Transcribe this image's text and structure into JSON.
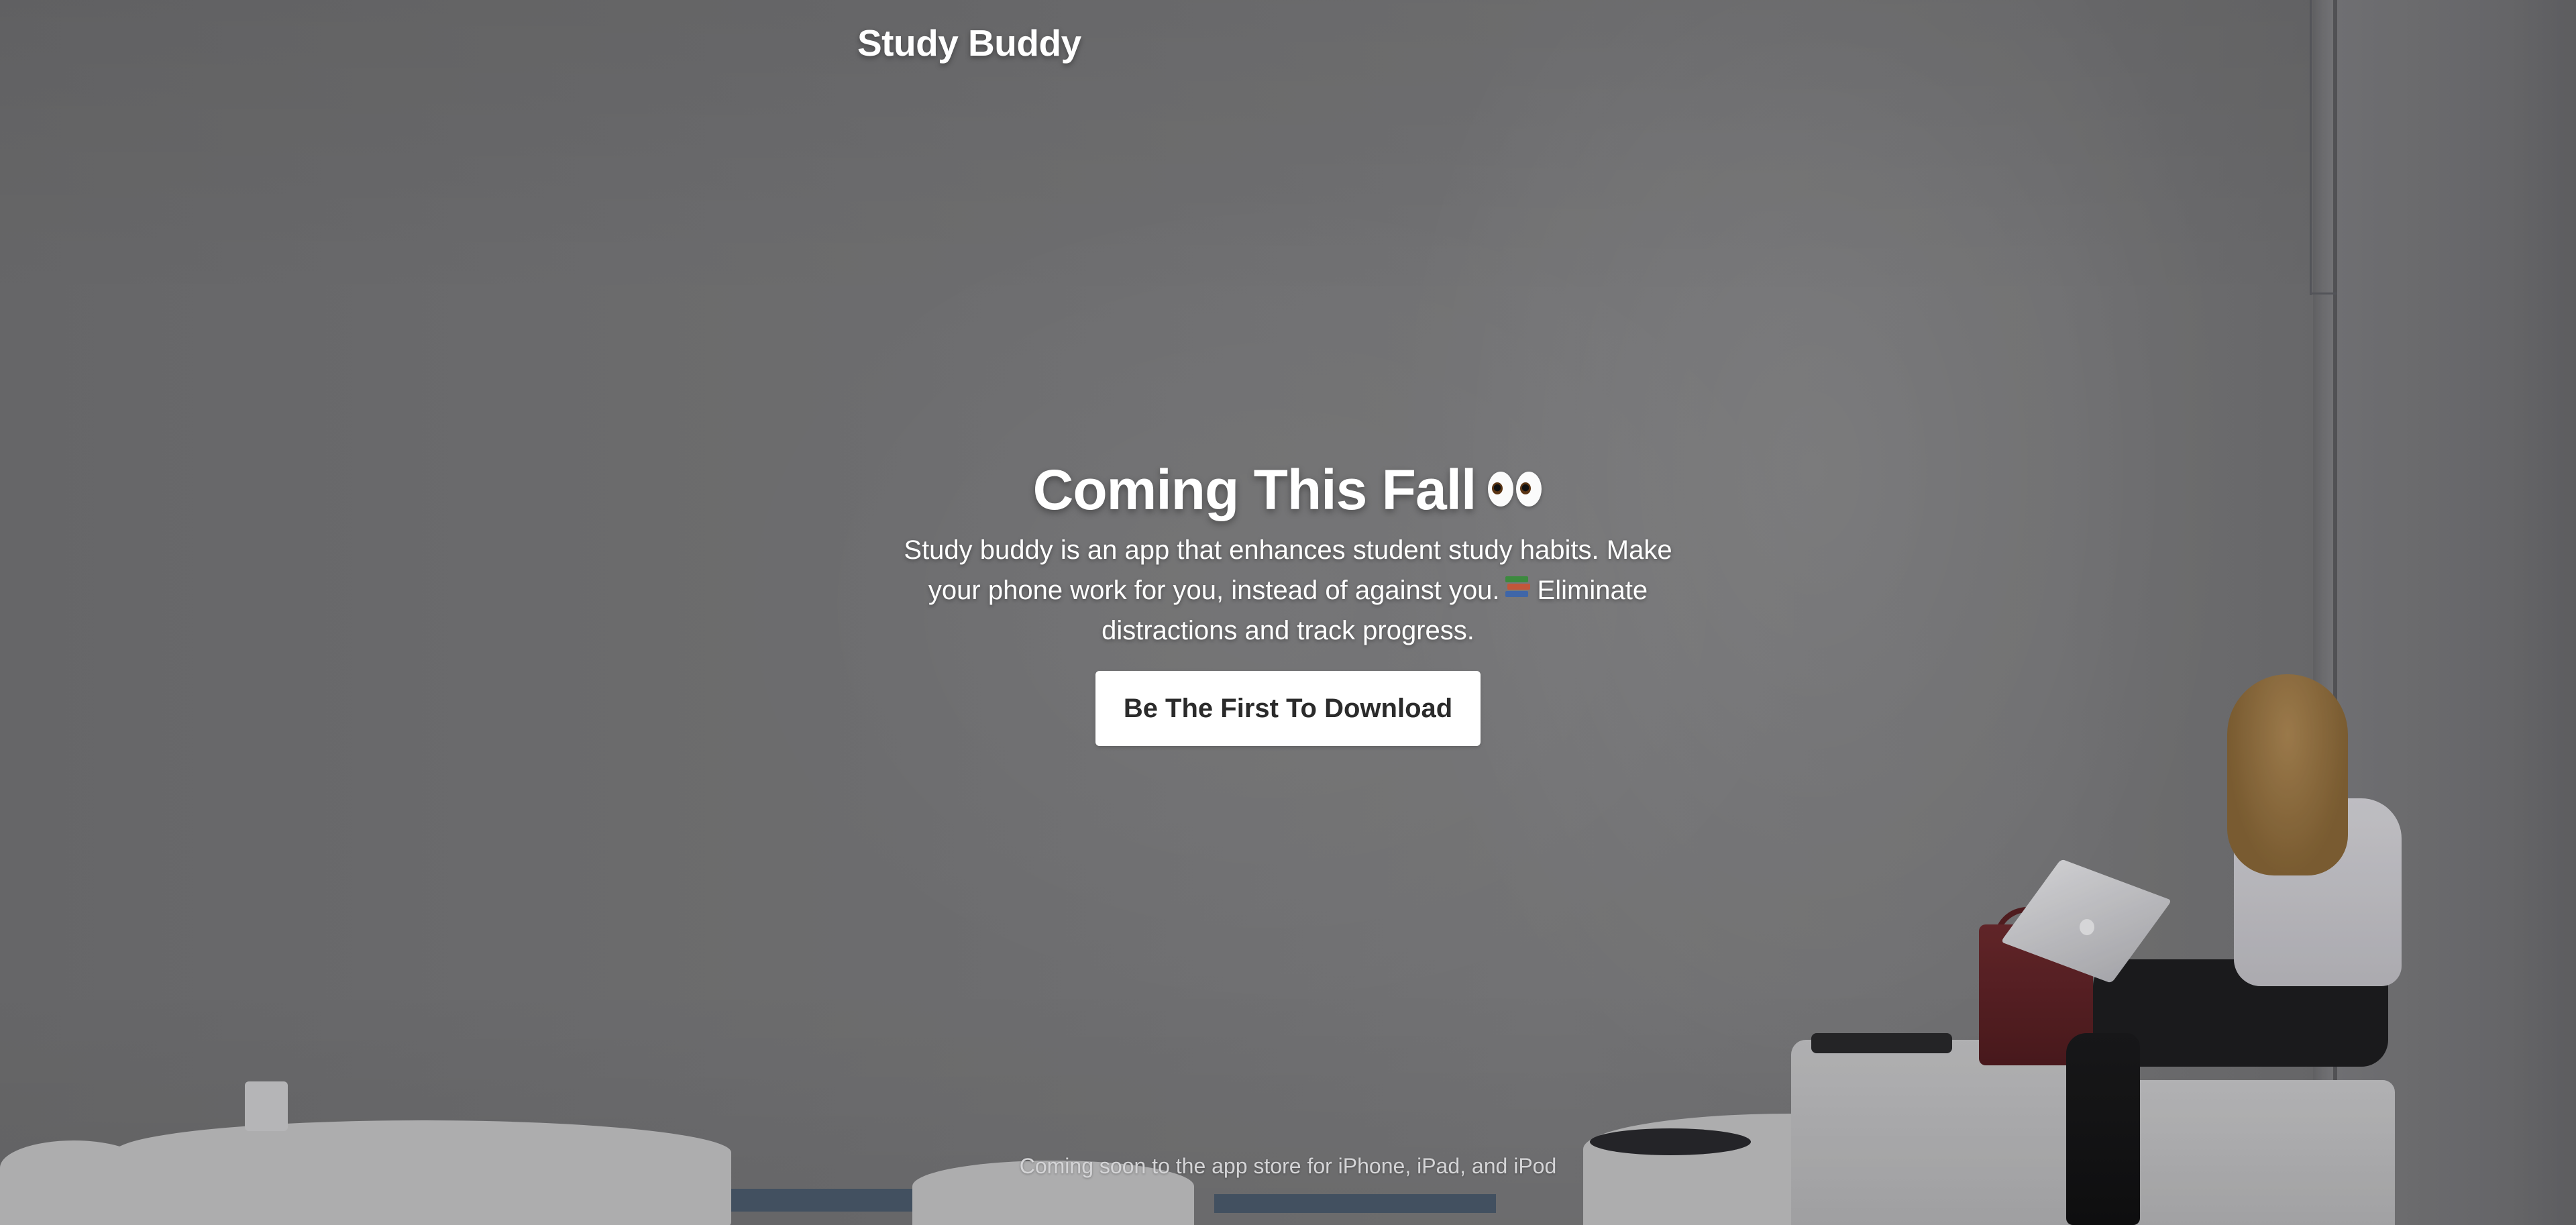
{
  "brand": {
    "name": "Study Buddy"
  },
  "hero": {
    "title": "Coming This Fall",
    "title_emoji": "eyes",
    "description_part1": "Study buddy is an app that enhances student study habits. Make your phone work for you, instead of against you.",
    "description_emoji": "books",
    "description_part2": "Eliminate distractions and track progress.",
    "cta_label": "Be The First To Download"
  },
  "footer": {
    "text": "Coming soon to the app store for iPhone, iPad, and iPod"
  },
  "colors": {
    "background_gray": "#7b7b7d",
    "text_white": "#ffffff",
    "button_bg": "#ffffff",
    "button_text": "#2b2b2b",
    "footer_text": "#d4d4d6"
  }
}
